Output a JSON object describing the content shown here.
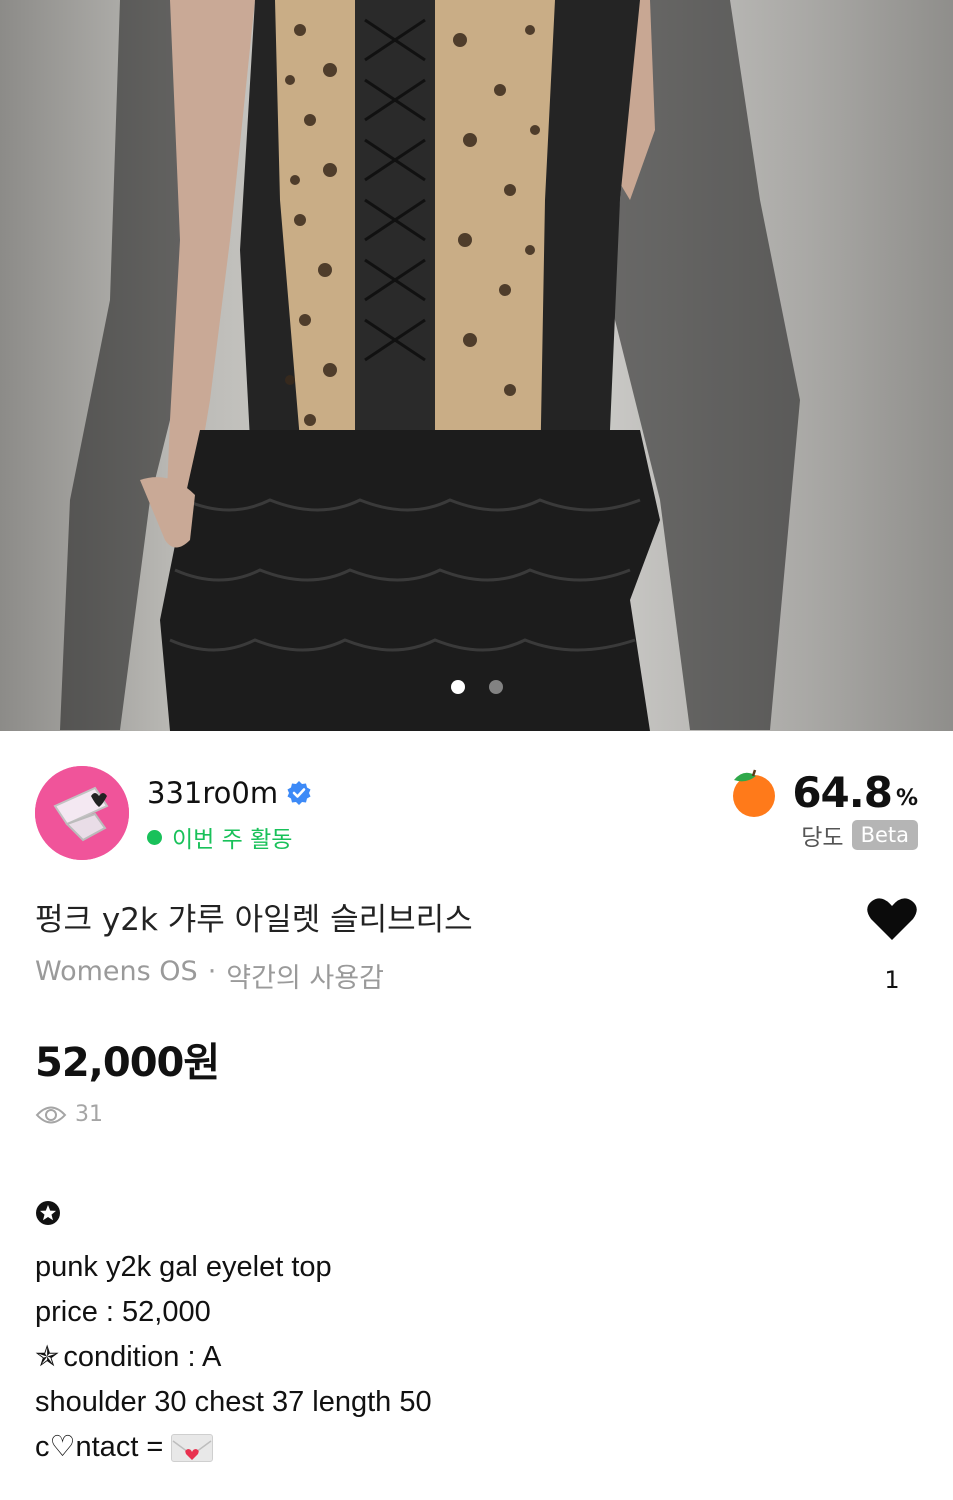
{
  "gallery": {
    "image_alt": "leopard print lace-up top with black ruffled skirt",
    "page_count": 2,
    "current_page": 1
  },
  "seller": {
    "username": "331ro0m",
    "verified": true,
    "activity_status": "이번 주 활동",
    "avatar_icon": "pink-avatar"
  },
  "sweetness": {
    "value": "64.8",
    "unit": "%",
    "label": "당도",
    "badge": "Beta",
    "icon": "orange-fruit-icon"
  },
  "product": {
    "title": "펑크 y2k 갸루 아일렛 슬리브리스",
    "category": "Womens OS",
    "separator": "·",
    "condition": "약간의 사용감",
    "price": "52,000원",
    "views": "31",
    "likes": "1"
  },
  "description": {
    "lines": [
      "punk y2k gal eyelet top",
      "price : 52,000",
      "condition : A",
      "shoulder 30 chest 37 length 50",
      "ntact = "
    ],
    "line3_prefix": "✯",
    "line5_prefix": "c",
    "line5_heart": "♡"
  },
  "colors": {
    "activity_green": "#19c15a",
    "avatar_pink": "#f0549a",
    "verified_blue": "#3d8af7",
    "orange": "#ff7a1a"
  }
}
